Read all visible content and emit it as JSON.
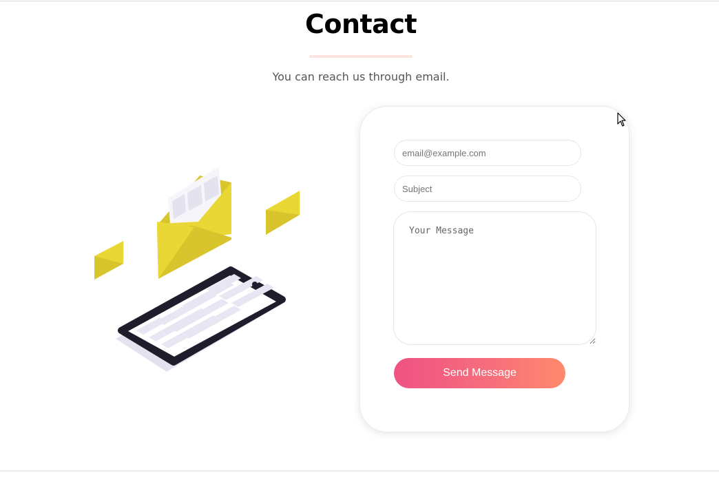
{
  "header": {
    "title": "Contact",
    "subtitle": "You can reach us through email."
  },
  "illustration": {
    "icon": "mail-phone-illustration",
    "envelope_color": "#e9d735",
    "phone_color": "#1f1d2b"
  },
  "form": {
    "email_placeholder": "email@example.com",
    "email_value": "",
    "subject_placeholder": "Subject",
    "subject_value": "",
    "message_placeholder": "Your Message",
    "message_value": "",
    "send_label": "Send Message"
  },
  "colors": {
    "button_gradient_start": "#ef5283",
    "button_gradient_end": "#fe8a6b",
    "underline": "#fde4e1"
  }
}
